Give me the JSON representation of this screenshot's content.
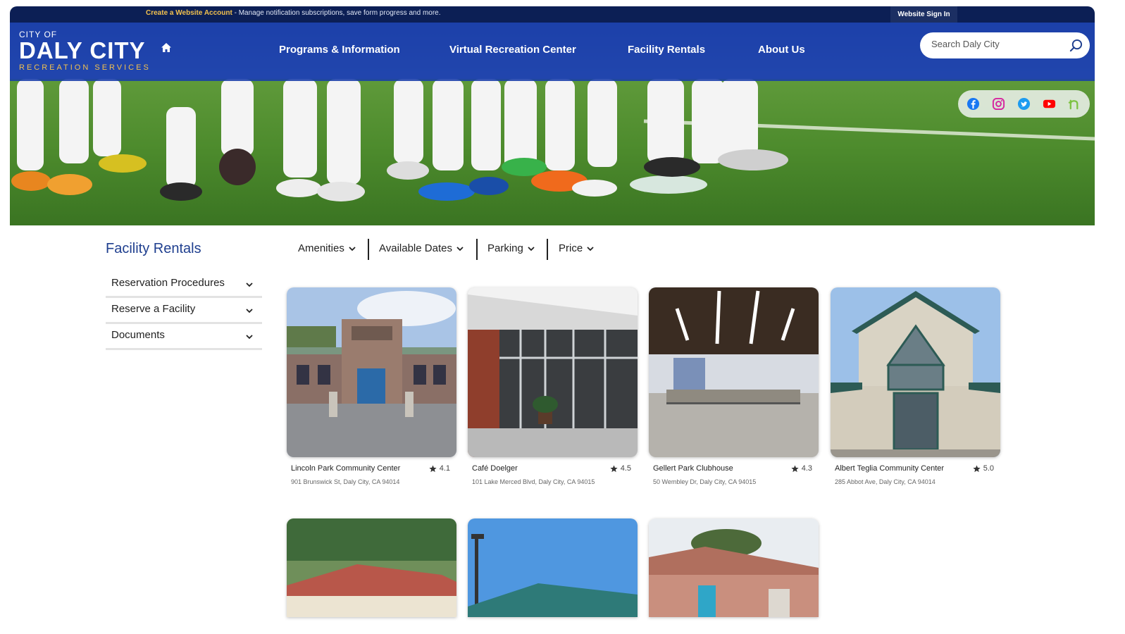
{
  "topbar": {
    "create_account": "Create a Website Account",
    "message": " - Manage notification subscriptions, save form progress and more.",
    "sign_in": "Website Sign In"
  },
  "logo": {
    "city_of": "CITY OF",
    "name": "DALY CITY",
    "department": "RECREATION SERVICES"
  },
  "nav": {
    "items": [
      {
        "label": "Programs & Information"
      },
      {
        "label": "Virtual Recreation Center"
      },
      {
        "label": "Facility Rentals"
      },
      {
        "label": "About Us"
      }
    ]
  },
  "search": {
    "placeholder": "Search Daly City"
  },
  "social": [
    "facebook-icon",
    "instagram-icon",
    "twitter-icon",
    "youtube-icon",
    "nextdoor-icon"
  ],
  "sidebar": {
    "title": "Facility Rentals",
    "items": [
      {
        "label": "Reservation Procedures"
      },
      {
        "label": "Reserve a Facility"
      },
      {
        "label": "Documents"
      }
    ]
  },
  "filters": [
    {
      "label": "Amenities"
    },
    {
      "label": "Available Dates"
    },
    {
      "label": "Parking"
    },
    {
      "label": "Price"
    }
  ],
  "facilities": [
    {
      "name": "Lincoln Park Community Center",
      "rating": "4.1",
      "address": "901 Brunswick St, Daly City, CA 94014"
    },
    {
      "name": "Café Doelger",
      "rating": "4.5",
      "address": "101 Lake Merced Blvd, Daly City, CA 94015"
    },
    {
      "name": "Gellert Park Clubhouse",
      "rating": "4.3",
      "address": "50 Wembley Dr, Daly City, CA 94015"
    },
    {
      "name": "Albert Teglia Community Center",
      "rating": "5.0",
      "address": "285 Abbot Ave, Daly City, CA 94014"
    }
  ],
  "colors": {
    "nav_blue": "#1a3caa",
    "topbar_navy": "#0c1f55",
    "accent_gold": "#f2c14e",
    "title_blue": "#1f3f8f"
  }
}
